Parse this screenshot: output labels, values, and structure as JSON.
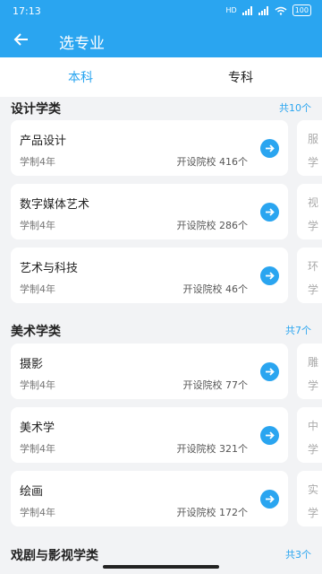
{
  "status": {
    "time": "17:13",
    "signal": "HD",
    "battery": "100"
  },
  "appbar": {
    "title": "选专业"
  },
  "tabs": [
    {
      "label": "本科",
      "active": true
    },
    {
      "label": "专科",
      "active": false
    }
  ],
  "sections": [
    {
      "title": "设计学类",
      "count": "共10个",
      "items": [
        {
          "name": "产品设计",
          "years": "学制4年",
          "schools": "开设院校 416个"
        },
        {
          "name": "数字媒体艺术",
          "years": "学制4年",
          "schools": "开设院校 286个"
        },
        {
          "name": "艺术与科技",
          "years": "学制4年",
          "schools": "开设院校 46个"
        }
      ],
      "peek": [
        [
          "服",
          "学"
        ],
        [
          "视",
          "学"
        ],
        [
          "环",
          "学"
        ]
      ]
    },
    {
      "title": "美术学类",
      "count": "共7个",
      "items": [
        {
          "name": "摄影",
          "years": "学制4年",
          "schools": "开设院校 77个"
        },
        {
          "name": "美术学",
          "years": "学制4年",
          "schools": "开设院校 321个"
        },
        {
          "name": "绘画",
          "years": "学制4年",
          "schools": "开设院校 172个"
        }
      ],
      "peek": [
        [
          "雕",
          "学"
        ],
        [
          "中",
          "学"
        ],
        [
          "实",
          "学"
        ]
      ]
    },
    {
      "title": "戏剧与影视学类",
      "count": "共3个",
      "items": [],
      "peek": []
    }
  ],
  "colors": {
    "primary": "#2aa5f0",
    "background": "#f2f3f5"
  }
}
